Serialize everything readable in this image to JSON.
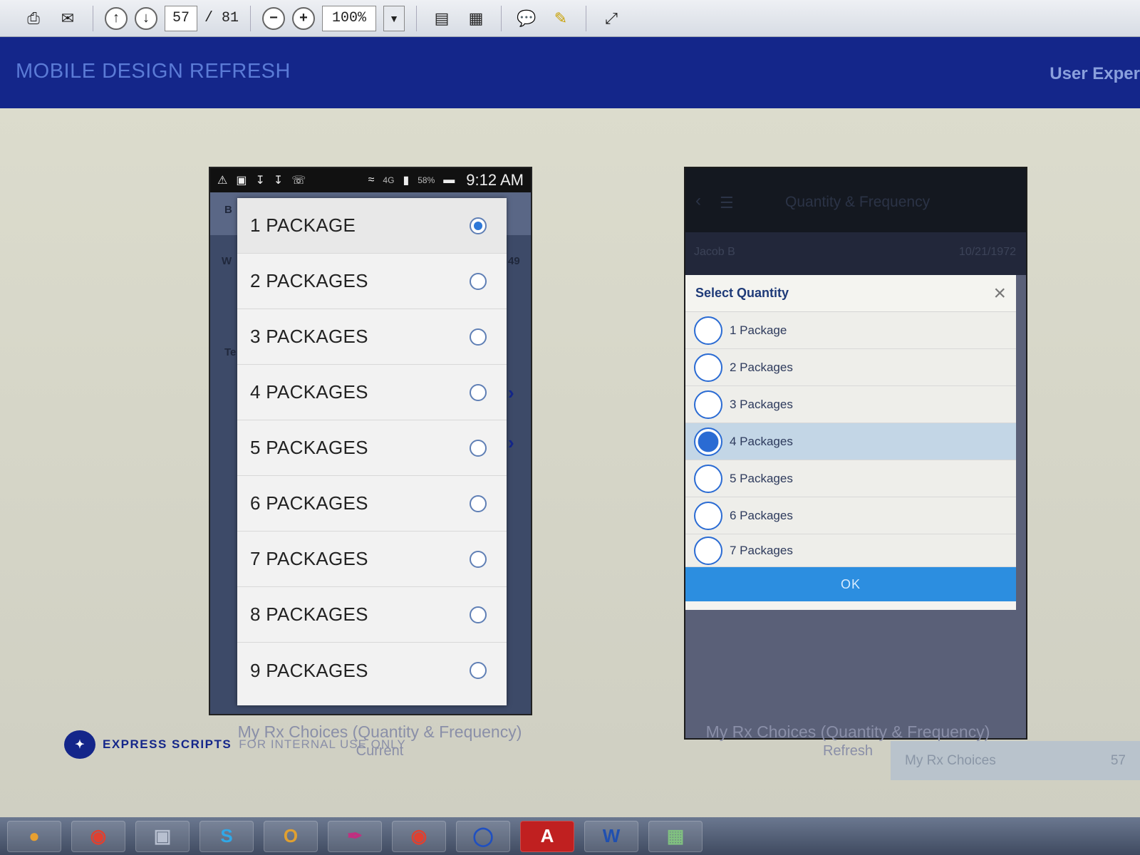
{
  "toolbar": {
    "page_current": "57",
    "page_total": "/ 81",
    "zoom": "100%",
    "icons": [
      "print-icon",
      "email-icon",
      "page-up-icon",
      "page-down-icon",
      "zoom-out-icon",
      "zoom-in-icon",
      "dropdown-icon",
      "fit-width-icon",
      "fit-page-icon",
      "comment-icon",
      "sign-icon",
      "fullscreen-icon"
    ]
  },
  "slide": {
    "title": "MOBILE DESIGN REFRESH",
    "right_title": "User Exper"
  },
  "current_phone": {
    "status_time": "9:12 AM",
    "status_battery": "58%",
    "status_network": "4G",
    "selected_index": 0,
    "options": [
      "1 PACKAGE",
      "2 PACKAGES",
      "3 PACKAGES",
      "4 PACKAGES",
      "5 PACKAGES",
      "6 PACKAGES",
      "7 PACKAGES",
      "8 PACKAGES",
      "9 PACKAGES"
    ],
    "bg_fragments": {
      "a": "W",
      "b": "49",
      "c": "Te",
      "d": "B"
    },
    "caption": "My Rx Choices (Quantity & Frequency)",
    "caption_sub": "Current"
  },
  "refresh_phone": {
    "header_title": "Quantity & Frequency",
    "member_name": "Jacob B",
    "member_date": "10/21/1972",
    "dialog_title": "Select Quantity",
    "selected_index": 3,
    "options": [
      "1 Package",
      "2 Packages",
      "3 Packages",
      "4 Packages",
      "5 Packages",
      "6 Packages",
      "7 Packages"
    ],
    "ok_label": "OK",
    "caption": "My Rx Choices (Quantity & Frequency)",
    "caption_sub": "Refresh"
  },
  "footer": {
    "brand": "EXPRESS SCRIPTS",
    "note": "FOR INTERNAL USE ONLY",
    "section": "My Rx Choices",
    "page_number": "57"
  },
  "colors": {
    "header_blue": "#14268a",
    "ok_blue": "#2c8ee0",
    "radio_blue": "#2a6bd3"
  }
}
